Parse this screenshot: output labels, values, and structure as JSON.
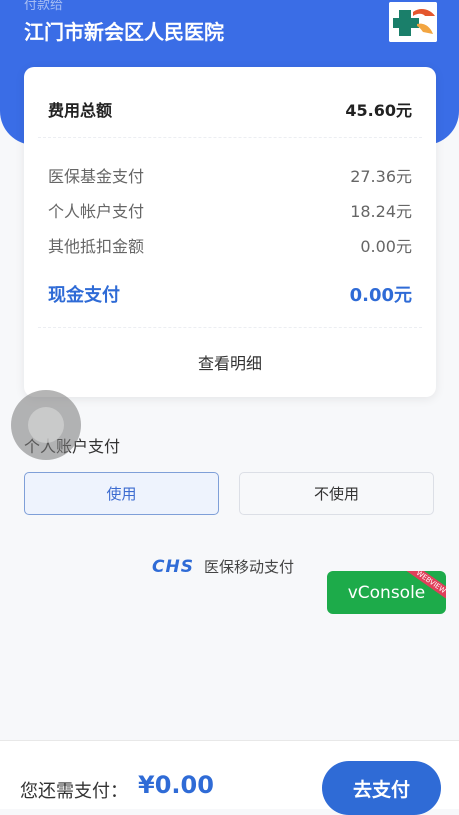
{
  "header": {
    "subtitle": "付款给",
    "hospital": "江门市新会区人民医院"
  },
  "summary": {
    "total_label": "费用总额",
    "total_value": "45.60元",
    "items": [
      {
        "label": "医保基金支付",
        "value": "27.36元"
      },
      {
        "label": "个人帐户支付",
        "value": "18.24元"
      },
      {
        "label": "其他抵扣金额",
        "value": "0.00元"
      }
    ],
    "cash_label": "现金支付",
    "cash_value": "0.00元",
    "detail_link": "查看明细"
  },
  "account": {
    "label": "个人账户支付",
    "use": "使用",
    "not_use": "不使用"
  },
  "brand": {
    "mark": "CHS",
    "text": "医保移动支付"
  },
  "vconsole": {
    "label": "vConsole",
    "ribbon": "WEBVIEW"
  },
  "footer": {
    "need_label": "您还需支付：",
    "amount": "¥0.00",
    "pay_button": "去支付"
  },
  "colors": {
    "primary": "#3a6de6",
    "accent_text": "#2f6bd6",
    "vconsole": "#1dab4a"
  }
}
